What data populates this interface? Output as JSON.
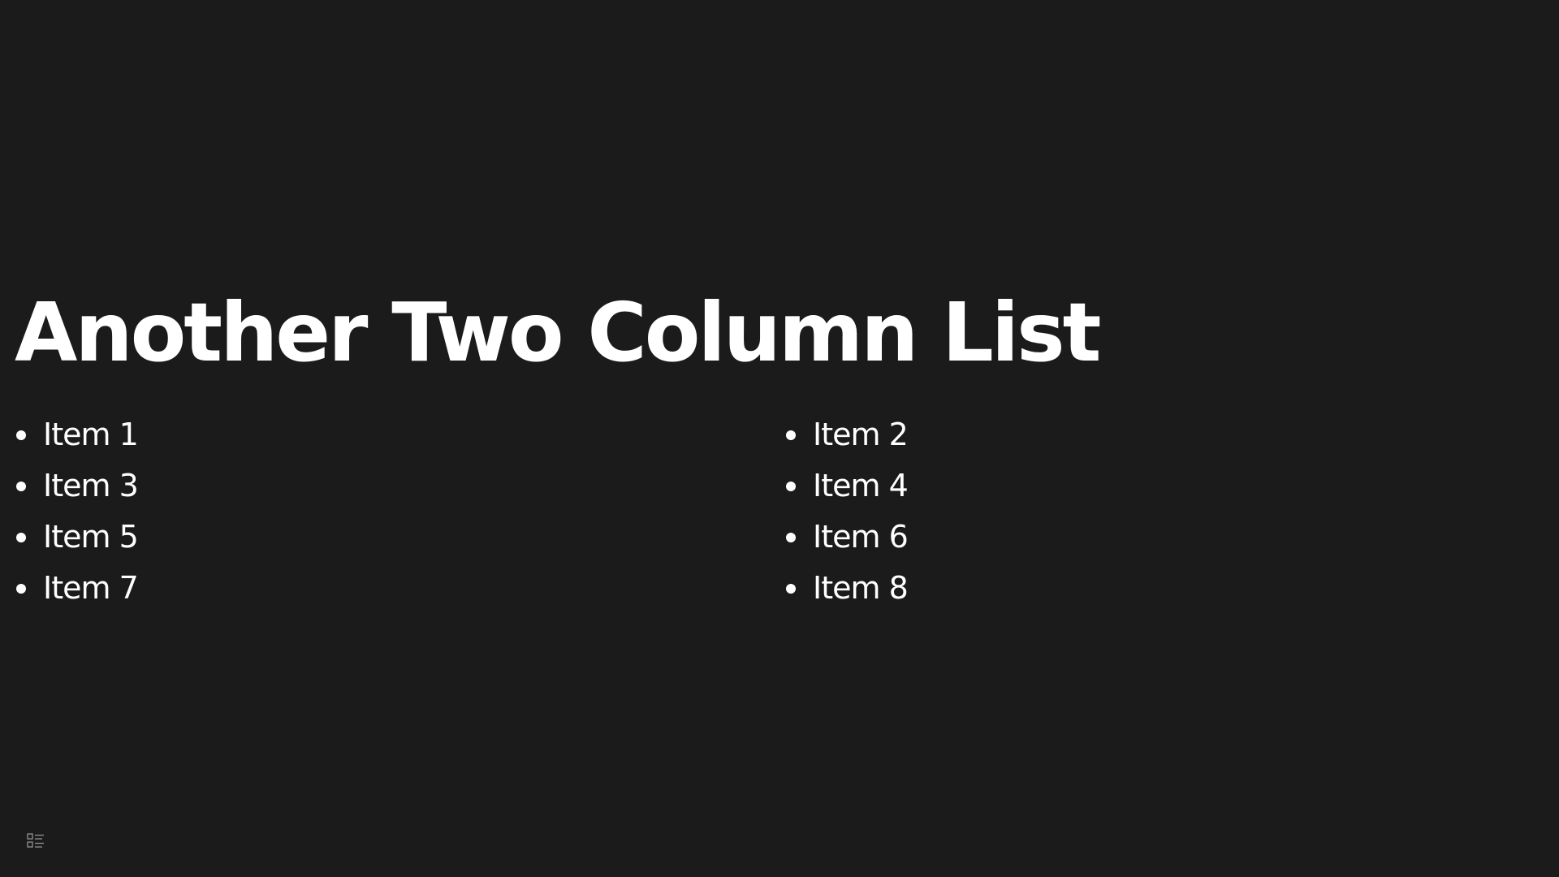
{
  "slide": {
    "title": "Another Two Column List",
    "left_column": [
      "Item 1",
      "Item 3",
      "Item 5",
      "Item 7"
    ],
    "right_column": [
      "Item 2",
      "Item 4",
      "Item 6",
      "Item 8"
    ]
  },
  "controls": {
    "menu_icon": "list-menu-icon"
  },
  "colors": {
    "background": "#1b1b1b",
    "text": "#ffffff",
    "icon": "#8a8a8a"
  }
}
